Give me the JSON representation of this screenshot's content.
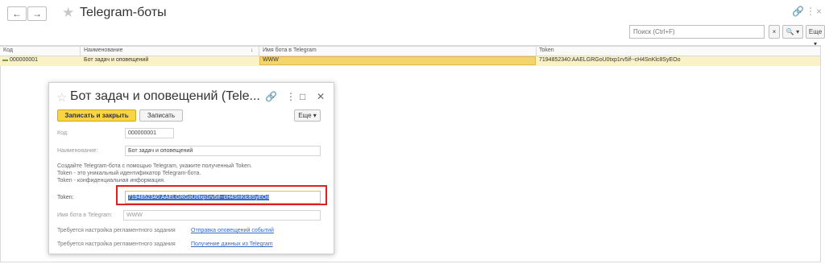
{
  "window": {
    "title": "Telegram-боты",
    "back_icon": "←",
    "forward_icon": "→",
    "star_icon": "★",
    "link_icon": "🔗",
    "more_icon": "⋮",
    "close_icon": "×"
  },
  "search": {
    "placeholder": "Поиск (Ctrl+F)",
    "clear_label": "×",
    "find_label": "🔍 ▾",
    "more_label": "Еще ▾"
  },
  "table": {
    "columns": [
      "Код",
      "Наименование",
      "Имя бота в Telegram",
      "Token"
    ],
    "sort_indicator": "↓",
    "rows": [
      {
        "icon": "▬",
        "code": "000000001",
        "name": "Бот задач и оповещений",
        "bot_name": "WWW",
        "token": "7194852340:AAELGRGoU0txp1rv5if--cH4SnKlc8SyEOo"
      }
    ]
  },
  "dialog": {
    "title": "Бот задач и оповещений (Tele...",
    "star_icon": "☆",
    "link_icon": "🔗",
    "more_icon": "⋮",
    "maximize_icon": "□",
    "close_icon": "✕",
    "save_close_label": "Записать и закрыть",
    "save_label": "Записать",
    "more_label": "Еще ▾",
    "code_label": "Код:",
    "code_value": "000000001",
    "name_label": "Наименование:",
    "name_value": "Бот задач и оповещений",
    "info_line1": "Создайте Telegram-бота с помощью Telegram, укажите полученный Token.",
    "info_line2": "Token - это уникальный идентификатор Telegram-бота.",
    "info_line3": "Token - конфиденциальная информация.",
    "token_label": "Token:",
    "token_value": "7194852340:AAELGRGoU0txp1rv5if--cH4SnKlc8SyEOo",
    "bot_name_label": "Имя бота в Telegram:",
    "bot_name_value": "WWW",
    "task_note_1": "Требуется настройка регламентного задания",
    "task_link_1": "Отправка оповещений событий",
    "task_note_2": "Требуется настройка регламентного задания",
    "task_link_2": "Получение данных из Telegram"
  },
  "colors": {
    "accent": "#f9d443",
    "selected_row": "#fbf1c6",
    "highlight_box": "#e02020",
    "link": "#3366cc"
  }
}
